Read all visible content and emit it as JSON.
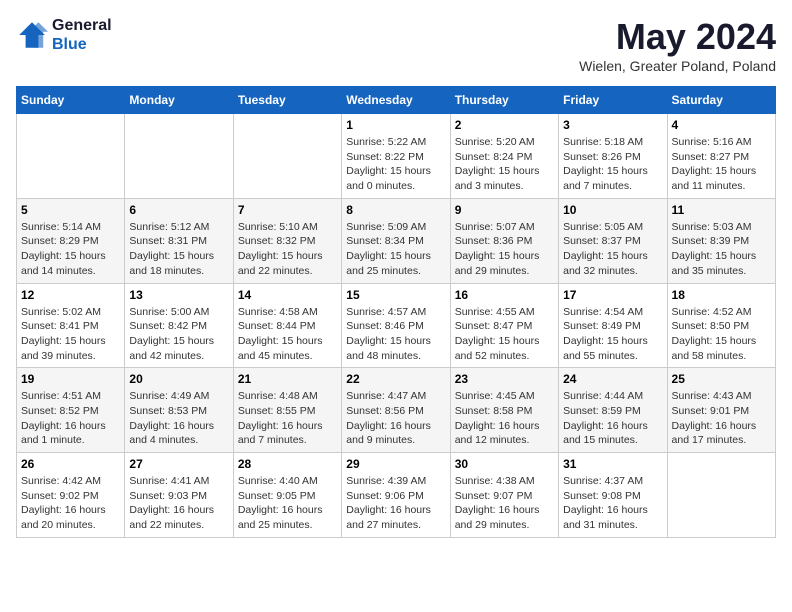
{
  "header": {
    "logo_line1": "General",
    "logo_line2": "Blue",
    "month_title": "May 2024",
    "location": "Wielen, Greater Poland, Poland"
  },
  "weekdays": [
    "Sunday",
    "Monday",
    "Tuesday",
    "Wednesday",
    "Thursday",
    "Friday",
    "Saturday"
  ],
  "weeks": [
    [
      {
        "day": "",
        "info": ""
      },
      {
        "day": "",
        "info": ""
      },
      {
        "day": "",
        "info": ""
      },
      {
        "day": "1",
        "info": "Sunrise: 5:22 AM\nSunset: 8:22 PM\nDaylight: 15 hours\nand 0 minutes."
      },
      {
        "day": "2",
        "info": "Sunrise: 5:20 AM\nSunset: 8:24 PM\nDaylight: 15 hours\nand 3 minutes."
      },
      {
        "day": "3",
        "info": "Sunrise: 5:18 AM\nSunset: 8:26 PM\nDaylight: 15 hours\nand 7 minutes."
      },
      {
        "day": "4",
        "info": "Sunrise: 5:16 AM\nSunset: 8:27 PM\nDaylight: 15 hours\nand 11 minutes."
      }
    ],
    [
      {
        "day": "5",
        "info": "Sunrise: 5:14 AM\nSunset: 8:29 PM\nDaylight: 15 hours\nand 14 minutes."
      },
      {
        "day": "6",
        "info": "Sunrise: 5:12 AM\nSunset: 8:31 PM\nDaylight: 15 hours\nand 18 minutes."
      },
      {
        "day": "7",
        "info": "Sunrise: 5:10 AM\nSunset: 8:32 PM\nDaylight: 15 hours\nand 22 minutes."
      },
      {
        "day": "8",
        "info": "Sunrise: 5:09 AM\nSunset: 8:34 PM\nDaylight: 15 hours\nand 25 minutes."
      },
      {
        "day": "9",
        "info": "Sunrise: 5:07 AM\nSunset: 8:36 PM\nDaylight: 15 hours\nand 29 minutes."
      },
      {
        "day": "10",
        "info": "Sunrise: 5:05 AM\nSunset: 8:37 PM\nDaylight: 15 hours\nand 32 minutes."
      },
      {
        "day": "11",
        "info": "Sunrise: 5:03 AM\nSunset: 8:39 PM\nDaylight: 15 hours\nand 35 minutes."
      }
    ],
    [
      {
        "day": "12",
        "info": "Sunrise: 5:02 AM\nSunset: 8:41 PM\nDaylight: 15 hours\nand 39 minutes."
      },
      {
        "day": "13",
        "info": "Sunrise: 5:00 AM\nSunset: 8:42 PM\nDaylight: 15 hours\nand 42 minutes."
      },
      {
        "day": "14",
        "info": "Sunrise: 4:58 AM\nSunset: 8:44 PM\nDaylight: 15 hours\nand 45 minutes."
      },
      {
        "day": "15",
        "info": "Sunrise: 4:57 AM\nSunset: 8:46 PM\nDaylight: 15 hours\nand 48 minutes."
      },
      {
        "day": "16",
        "info": "Sunrise: 4:55 AM\nSunset: 8:47 PM\nDaylight: 15 hours\nand 52 minutes."
      },
      {
        "day": "17",
        "info": "Sunrise: 4:54 AM\nSunset: 8:49 PM\nDaylight: 15 hours\nand 55 minutes."
      },
      {
        "day": "18",
        "info": "Sunrise: 4:52 AM\nSunset: 8:50 PM\nDaylight: 15 hours\nand 58 minutes."
      }
    ],
    [
      {
        "day": "19",
        "info": "Sunrise: 4:51 AM\nSunset: 8:52 PM\nDaylight: 16 hours\nand 1 minute."
      },
      {
        "day": "20",
        "info": "Sunrise: 4:49 AM\nSunset: 8:53 PM\nDaylight: 16 hours\nand 4 minutes."
      },
      {
        "day": "21",
        "info": "Sunrise: 4:48 AM\nSunset: 8:55 PM\nDaylight: 16 hours\nand 7 minutes."
      },
      {
        "day": "22",
        "info": "Sunrise: 4:47 AM\nSunset: 8:56 PM\nDaylight: 16 hours\nand 9 minutes."
      },
      {
        "day": "23",
        "info": "Sunrise: 4:45 AM\nSunset: 8:58 PM\nDaylight: 16 hours\nand 12 minutes."
      },
      {
        "day": "24",
        "info": "Sunrise: 4:44 AM\nSunset: 8:59 PM\nDaylight: 16 hours\nand 15 minutes."
      },
      {
        "day": "25",
        "info": "Sunrise: 4:43 AM\nSunset: 9:01 PM\nDaylight: 16 hours\nand 17 minutes."
      }
    ],
    [
      {
        "day": "26",
        "info": "Sunrise: 4:42 AM\nSunset: 9:02 PM\nDaylight: 16 hours\nand 20 minutes."
      },
      {
        "day": "27",
        "info": "Sunrise: 4:41 AM\nSunset: 9:03 PM\nDaylight: 16 hours\nand 22 minutes."
      },
      {
        "day": "28",
        "info": "Sunrise: 4:40 AM\nSunset: 9:05 PM\nDaylight: 16 hours\nand 25 minutes."
      },
      {
        "day": "29",
        "info": "Sunrise: 4:39 AM\nSunset: 9:06 PM\nDaylight: 16 hours\nand 27 minutes."
      },
      {
        "day": "30",
        "info": "Sunrise: 4:38 AM\nSunset: 9:07 PM\nDaylight: 16 hours\nand 29 minutes."
      },
      {
        "day": "31",
        "info": "Sunrise: 4:37 AM\nSunset: 9:08 PM\nDaylight: 16 hours\nand 31 minutes."
      },
      {
        "day": "",
        "info": ""
      }
    ]
  ]
}
